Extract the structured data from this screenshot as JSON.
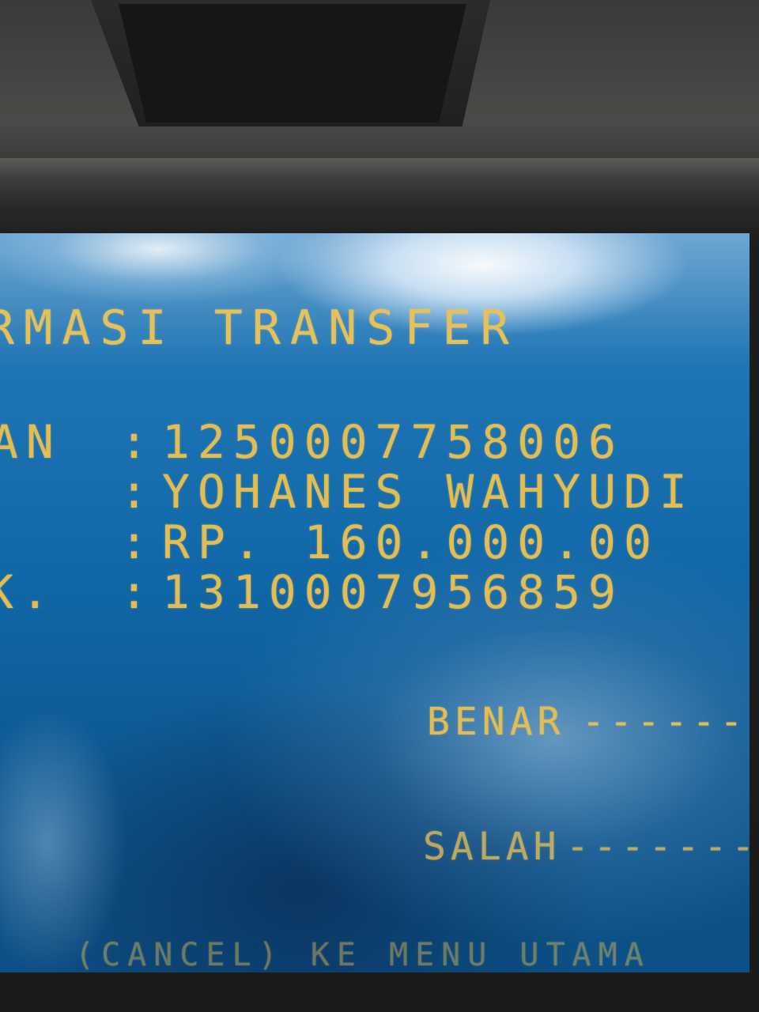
{
  "screen": {
    "title": "RMASI TRANSFER",
    "rows": [
      {
        "label": "AN",
        "value": "1250007758006"
      },
      {
        "label": "",
        "value": "YOHANES WAHYUDI"
      },
      {
        "label": "",
        "value": "RP. 160.000.00"
      },
      {
        "label": "K.",
        "value": "1310007956859"
      }
    ],
    "separator": ":",
    "options": {
      "benar_label": "BENAR",
      "benar_line": "-------",
      "salah_label": "SALAH",
      "salah_line": "-------"
    },
    "footer": "(CANCEL) KE MENU UTAMA"
  }
}
